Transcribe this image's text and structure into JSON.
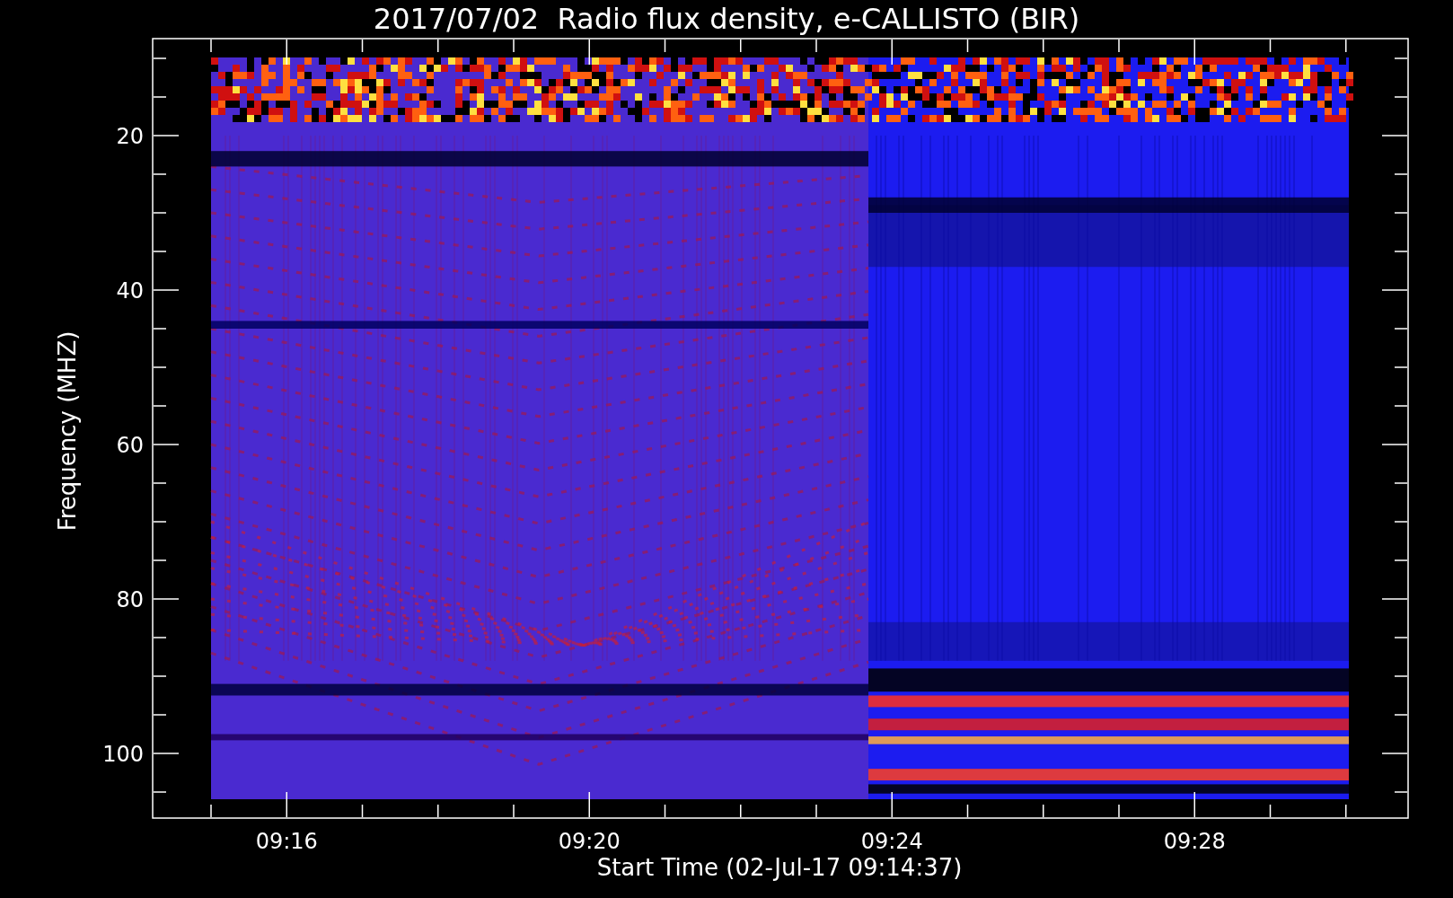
{
  "title": "2017/07/02  Radio flux density, e-CALLISTO (BIR)",
  "ylabel": "Frequency (MHZ)",
  "xlabel": "Start Time (02-Jul-17 09:14:37)",
  "yticks": [
    "20",
    "40",
    "60",
    "80",
    "100"
  ],
  "xticks": [
    "09:16",
    "09:20",
    "09:24",
    "09:28"
  ]
}
